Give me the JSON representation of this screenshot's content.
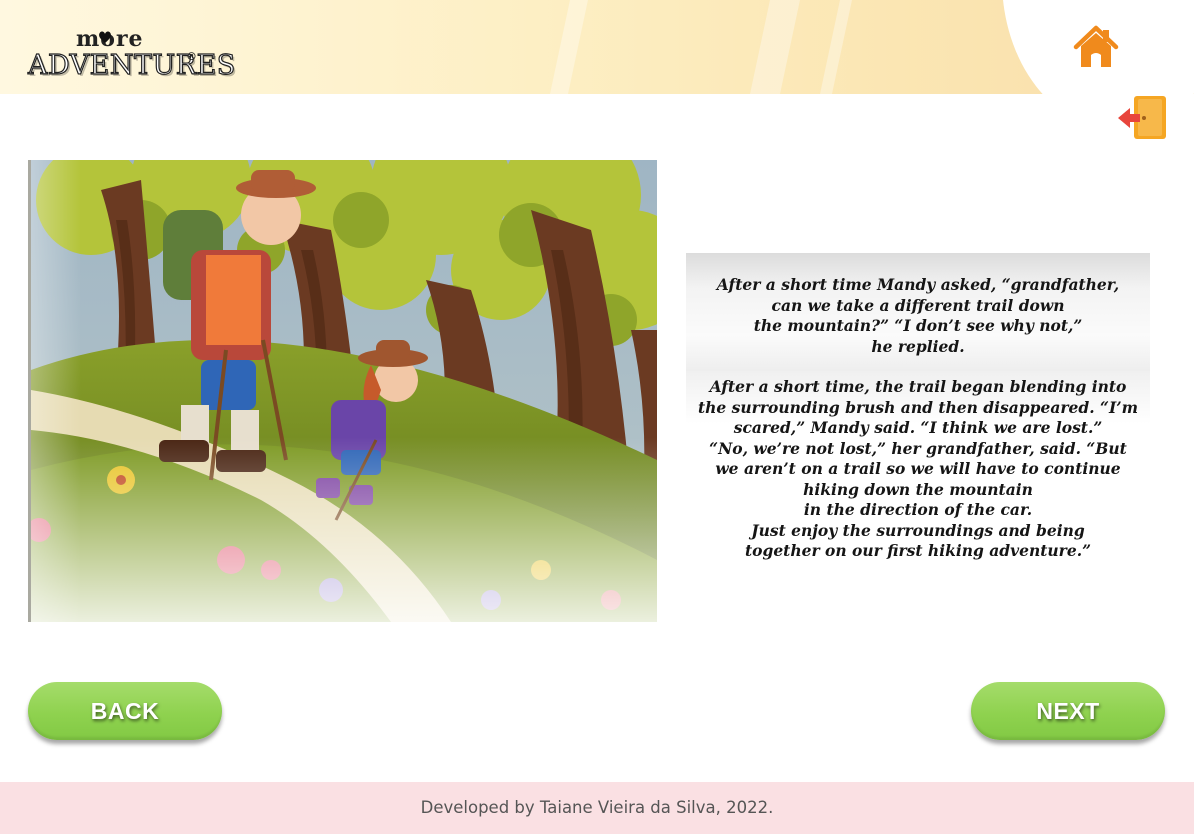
{
  "header": {
    "logo_small": "more",
    "logo_big": "ADVENTURES",
    "logo_mark": "®",
    "home_icon": "home-icon",
    "exit_icon": "exit-door-icon"
  },
  "story": {
    "paragraph1": [
      "After a short time Mandy asked, “grandfather,",
      "can we take a different trail down",
      "the mountain?” “I don’t see why not,”",
      "he replied."
    ],
    "paragraph2": [
      "After a short time, the trail began blending into",
      "the surrounding brush and then disappeared. “I’m",
      "scared,” Mandy said. “I think we are lost.”",
      "“No, we’re not lost,” her grandfather, said. “But",
      "we aren’t on a trail so we will have to continue",
      "hiking down the mountain",
      "in the direction of the car.",
      "Just enjoy the surroundings and being",
      "together on our first hiking adventure.”"
    ]
  },
  "nav": {
    "back_label": "BACK",
    "next_label": "NEXT"
  },
  "footer": {
    "credit": "Developed by Taiane Vieira da Silva, 2022."
  },
  "colors": {
    "accent_green": "#8fd24f",
    "home_orange": "#f08a1c",
    "exit_red": "#e8453c",
    "footer_pink": "#fae0e3"
  }
}
